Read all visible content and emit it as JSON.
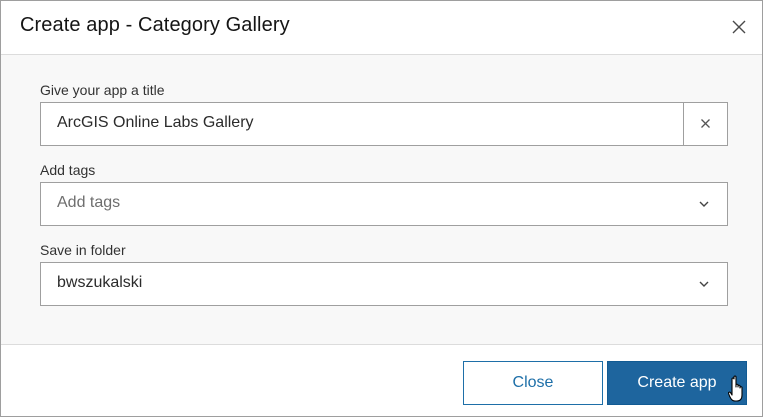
{
  "dialog": {
    "title": "Create app - Category Gallery",
    "close_icon": "close-icon"
  },
  "form": {
    "title_field": {
      "label": "Give your app a title",
      "value": "ArcGIS Online Labs Gallery",
      "clear_icon": "clear-icon"
    },
    "tags_field": {
      "label": "Add tags",
      "placeholder": "Add tags",
      "chevron_icon": "chevron-down-icon"
    },
    "folder_field": {
      "label": "Save in folder",
      "value": "bwszukalski",
      "chevron_icon": "chevron-down-icon"
    }
  },
  "footer": {
    "close_label": "Close",
    "create_label": "Create app"
  },
  "cursor": "hand-pointer-icon"
}
